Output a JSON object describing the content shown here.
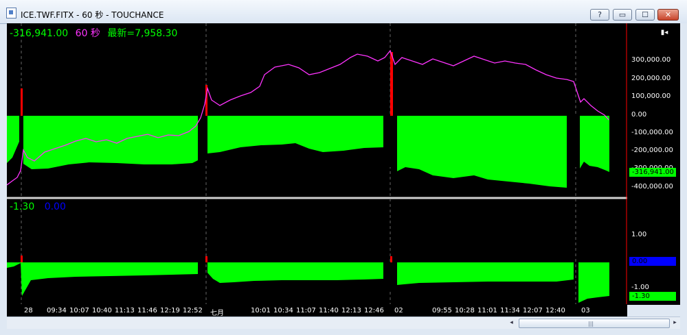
{
  "window": {
    "title": "ICE.TWF.FITX - 60 秒 - TOUCHANCE",
    "buttons": {
      "help": "?",
      "minimize": "▭",
      "maximize": "☐",
      "close": "✕"
    }
  },
  "top_panel": {
    "value": "-316,941.00",
    "period": "60 秒",
    "latest": "最新=7,958.30",
    "axis_labels": [
      "300,000.00",
      "200,000.00",
      "100,000.00",
      "0.00",
      "-100,000.00",
      "-200,000.00",
      "-300,000.00",
      "-400,000.00"
    ],
    "badge_value": "-316,941.00"
  },
  "bottom_panel": {
    "value1": "-1.30",
    "value2": "0.00",
    "axis_labels": [
      "1.00",
      "-1.00"
    ],
    "badge_blue": "0.00",
    "badge_green": "-1.30"
  },
  "time_axis": [
    "28",
    "09:34",
    "10:07",
    "10:40",
    "11:13",
    "11:46",
    "12:19",
    "12:52",
    "七月",
    "10:01",
    "10:34",
    "11:07",
    "11:40",
    "12:13",
    "12:46",
    "02",
    "09:55",
    "10:28",
    "11:01",
    "11:34",
    "12:07",
    "12:40",
    "03"
  ],
  "icons": {
    "pin": "pin-icon"
  },
  "colors": {
    "positive_bar": "#00ff00",
    "signal_bar": "#ff0000",
    "line": "#ff33ff",
    "text_green": "#00ff00",
    "text_blue": "#0000ff"
  }
}
